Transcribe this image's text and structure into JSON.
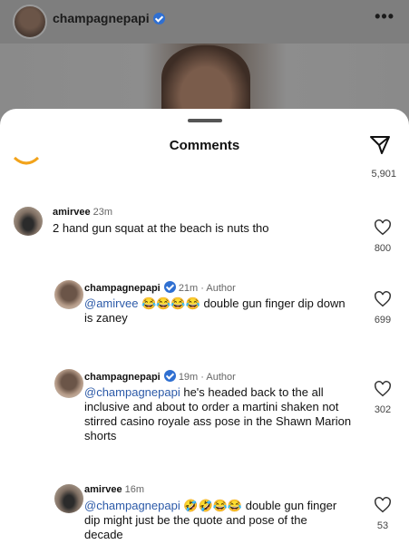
{
  "post": {
    "username": "champagnepapi",
    "more_icon": "•••"
  },
  "sheet": {
    "title": "Comments",
    "top_likes": "5,901"
  },
  "comments": [
    {
      "username": "amirvee",
      "time": "23m",
      "author_tag": "",
      "mention": "",
      "text": "2 hand gun squat at the beach is nuts tho",
      "likes": "800"
    },
    {
      "username": "champagnepapi",
      "time": "21m",
      "author_tag": "Author",
      "mention": "@amirvee",
      "emojis": "😂😂😂😂",
      "text_line1": "double gun finger dip down",
      "text_line2": "is zaney",
      "likes": "699"
    },
    {
      "username": "champagnepapi",
      "time": "19m",
      "author_tag": "Author",
      "mention": "@champagnepapi",
      "text_line1": "he's headed back to the all",
      "text_line2": "inclusive and about to order a martini shaken not",
      "text_line3": "stirred casino royale ass pose in the Shawn Marion",
      "text_line4": "shorts",
      "likes": "302"
    },
    {
      "username": "amirvee",
      "time": "16m",
      "author_tag": "",
      "mention": "@champagnepapi",
      "emojis": "🤣🤣😂😂",
      "text_line1": "double gun finger",
      "text_line2": "dip might just be the quote and pose of the",
      "text_line3": "decade",
      "likes": "53"
    }
  ]
}
